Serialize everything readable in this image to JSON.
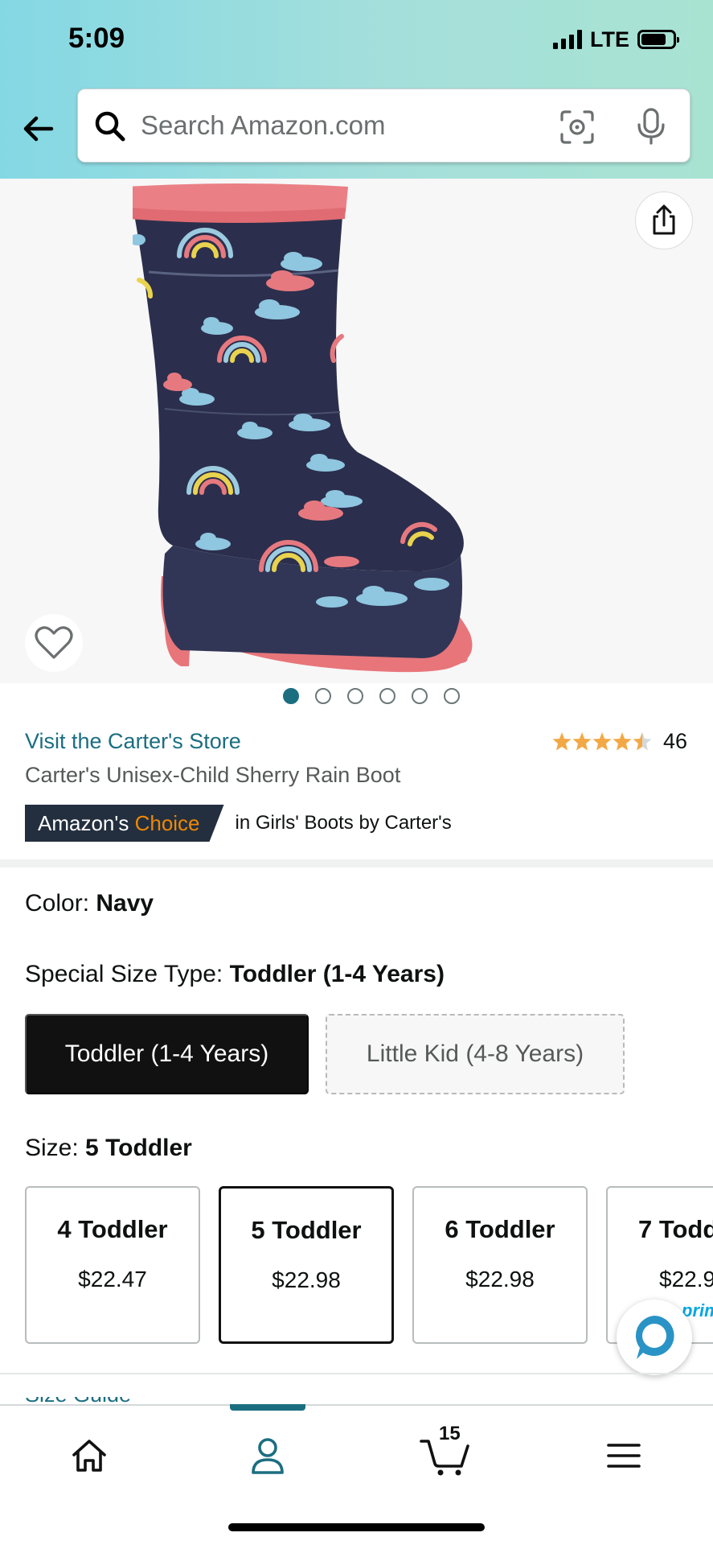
{
  "status_bar": {
    "time": "5:09",
    "network": "LTE"
  },
  "search": {
    "placeholder": "Search Amazon.com",
    "value": ""
  },
  "gallery": {
    "image_count": 6,
    "active_index": 0
  },
  "product": {
    "store_link": "Visit the Carter's Store",
    "title": "Carter's Unisex-Child Sherry Rain Boot",
    "rating": 4.5,
    "review_count": "46",
    "choice_badge": {
      "prefix": "Amazon's",
      "highlight": "Choice"
    },
    "choice_category": "in Girls' Boots by Carter's"
  },
  "color": {
    "label": "Color:",
    "value": "Navy"
  },
  "special_size_type": {
    "label": "Special Size Type:",
    "value": "Toddler (1-4 Years)",
    "options": [
      {
        "label": "Toddler (1-4 Years)",
        "selected": true
      },
      {
        "label": "Little Kid (4-8 Years)",
        "selected": false
      }
    ]
  },
  "size": {
    "label": "Size:",
    "value": "5 Toddler",
    "options": [
      {
        "size": "4 Toddler",
        "price": "$22.47",
        "selected": false
      },
      {
        "size": "5 Toddler",
        "price": "$22.98",
        "selected": true
      },
      {
        "size": "6 Toddler",
        "price": "$22.98",
        "selected": false
      },
      {
        "size": "7 Todd",
        "price": "$22.9",
        "prime_fragment": "prim",
        "selected": false
      }
    ]
  },
  "size_guide_peek": "Size Guide",
  "bottom_nav": {
    "cart_count": "15",
    "active": "account"
  },
  "colors": {
    "link": "#1b6e80",
    "selected_bg": "#111111",
    "star": "#f3a847",
    "badge_bg": "#232f3e",
    "badge_accent": "#f08804"
  }
}
